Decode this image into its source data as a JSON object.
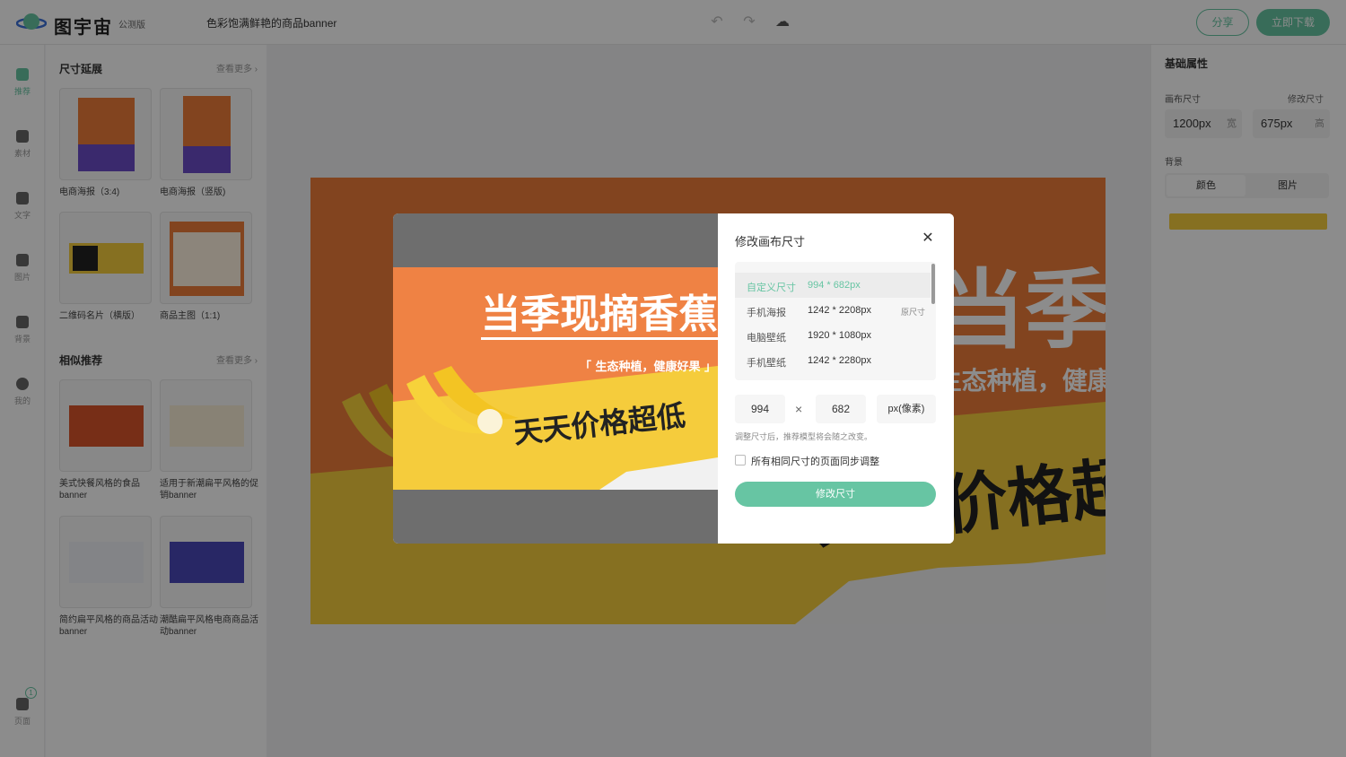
{
  "app": {
    "brand": "图宇宙",
    "beta": "公测版",
    "doc_title": "色彩饱满鲜艳的商品banner",
    "share_label": "分享",
    "download_label": "立即下载"
  },
  "rail": {
    "items": [
      {
        "label": "推荐"
      },
      {
        "label": "素材"
      },
      {
        "label": "文字"
      },
      {
        "label": "图片"
      },
      {
        "label": "背景"
      },
      {
        "label": "我的"
      },
      {
        "label": "页面"
      }
    ],
    "pages_count": "1"
  },
  "panel": {
    "section1": {
      "title": "尺寸延展",
      "more": "查看更多"
    },
    "templates1": [
      {
        "label": "电商海报（3:4)"
      },
      {
        "label": "电商海报（竖版)"
      },
      {
        "label": "二维码名片（横版）"
      },
      {
        "label": "商品主图（1:1)"
      }
    ],
    "section2": {
      "title": "相似推荐",
      "more": "查看更多"
    },
    "templates2": [
      {
        "label": "美式快餐风格的食品banner"
      },
      {
        "label": "适用于新潮扁平风格的促销banner"
      },
      {
        "label": "简约扁平风格的商品活动banner"
      },
      {
        "label": "潮酷扁平风格电商商品活动banner"
      }
    ]
  },
  "canvas": {
    "headline": "当季现摘香蕉",
    "subline": "「 生态种植，健康好果 」",
    "price_text": "天天价格超低",
    "bg_orange": "#ed7d3a",
    "bg_yellow": "#f5cc3c"
  },
  "right_panel": {
    "title": "基础属性",
    "canvas_size_label": "画布尺寸",
    "modify_size_label": "修改尺寸",
    "width_value": "1200px",
    "width_unit": "宽",
    "height_value": "675px",
    "height_unit": "高",
    "background_label": "背景",
    "seg_color": "颜色",
    "seg_image": "图片",
    "swatch_color": "#f5cc3c"
  },
  "modal": {
    "title": "修改画布尺寸",
    "sizes": [
      {
        "name": "自定义尺寸",
        "dim": "994 * 682px",
        "tag": ""
      },
      {
        "name": "手机海报",
        "dim": "1242 * 2208px",
        "tag": "原尺寸"
      },
      {
        "name": "电脑壁纸",
        "dim": "1920 * 1080px",
        "tag": ""
      },
      {
        "name": "手机壁纸",
        "dim": "1242 * 2280px",
        "tag": ""
      }
    ],
    "width": "994",
    "height": "682",
    "unit": "px(像素)",
    "hint": "调整尺寸后，推荐模型将会随之改变。",
    "sync_label": "所有相同尺寸的页面同步调整",
    "submit_label": "修改尺寸",
    "accent": "#67c5a3"
  }
}
